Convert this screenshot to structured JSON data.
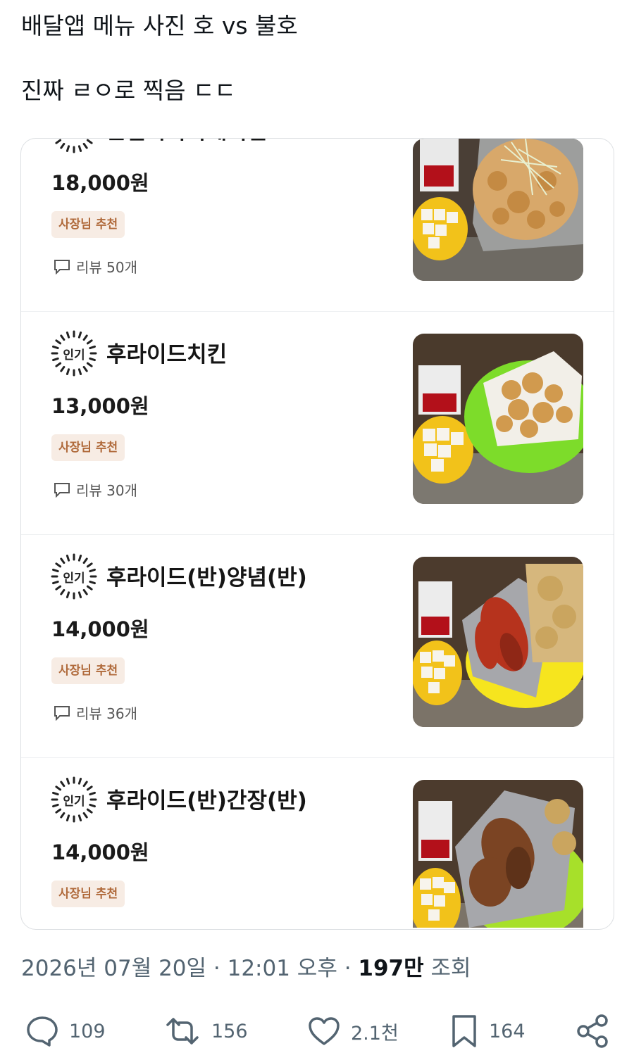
{
  "tweet": {
    "line1": "배달앱 메뉴 사진 호 vs 불호",
    "line2": "진짜 ㄹㅇ로 찍음 ㄷㄷ"
  },
  "menu": {
    "popular_badge": "인기",
    "owner_recommend": "사장님 추천",
    "items": [
      {
        "name": "순살가라아게치킨",
        "price": "18,000원",
        "review": "리뷰 50개"
      },
      {
        "name": "후라이드치킨",
        "price": "13,000원",
        "review": "리뷰 30개"
      },
      {
        "name": "후라이드(반)양념(반)",
        "price": "14,000원",
        "review": "리뷰 36개"
      },
      {
        "name": "후라이드(반)간장(반)",
        "price": "14,000원",
        "review": ""
      }
    ]
  },
  "meta": {
    "datetime": "2026년 07월 20일 · 12:01 오후",
    "separator": " · ",
    "views_count": "197만",
    "views_label": " 조회"
  },
  "actions": {
    "replies": "109",
    "retweets": "156",
    "likes": "2.1천",
    "bookmarks": "164"
  }
}
